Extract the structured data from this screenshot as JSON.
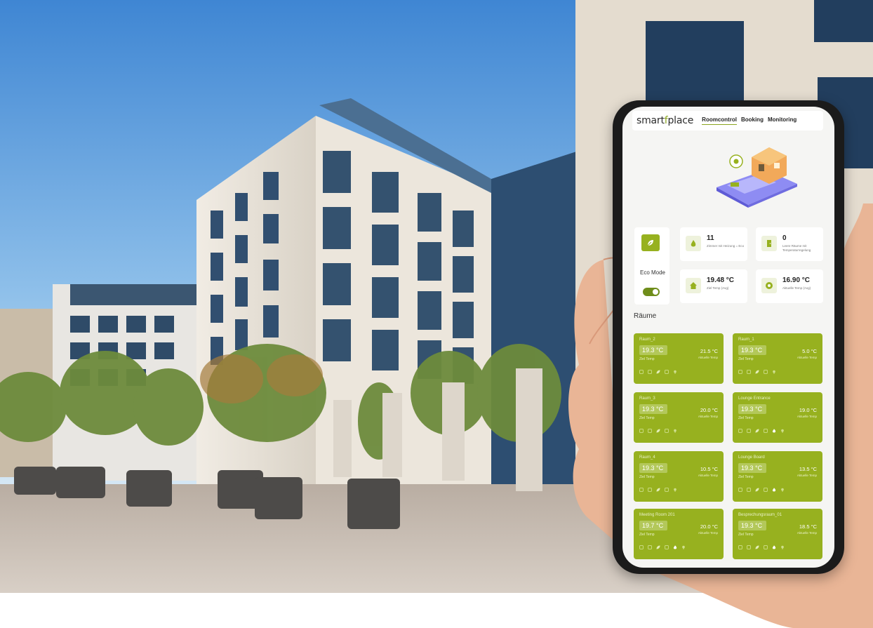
{
  "app": {
    "brand_prefix": "smart",
    "brand_mid": "f",
    "brand_suffix": "place",
    "tabs": [
      {
        "label": "Roomcontrol",
        "active": true
      },
      {
        "label": "Booking",
        "active": false
      },
      {
        "label": "Monitoring",
        "active": false
      }
    ]
  },
  "eco": {
    "label": "Eco Mode",
    "toggle_on": true
  },
  "stats": [
    {
      "value": "11",
      "label": "Zimmer mit Heizung = Eco",
      "icon": "flame-icon"
    },
    {
      "value": "0",
      "label": "Leere Räume mit Temperaturregelung",
      "icon": "door-icon"
    },
    {
      "value": "19.48 °C",
      "label": "Ziel Temp (Avg)",
      "icon": "home-icon"
    },
    {
      "value": "16.90 °C",
      "label": "Aktuelle Temp (Avg)",
      "icon": "thermo-icon"
    }
  ],
  "rooms_title": "Räume",
  "rooms": [
    {
      "name": "Raum_2",
      "target": "19.3 °C",
      "target_label": "Ziel Temp",
      "actual": "21.5 °C",
      "actual_label": "Aktuelle Temp",
      "flame": false
    },
    {
      "name": "Raum_1",
      "target": "19.3 °C",
      "target_label": "Ziel Temp",
      "actual": "5.0 °C",
      "actual_label": "Aktuelle Temp",
      "flame": false
    },
    {
      "name": "Raum_3",
      "target": "19.3 °C",
      "target_label": "Ziel Temp",
      "actual": "20.0 °C",
      "actual_label": "Aktuelle Temp",
      "flame": false
    },
    {
      "name": "Lounge Entrance",
      "target": "19.3 °C",
      "target_label": "Ziel Temp",
      "actual": "19.0 °C",
      "actual_label": "Aktuelle Temp",
      "flame": true
    },
    {
      "name": "Raum_4",
      "target": "19.3 °C",
      "target_label": "Ziel Temp",
      "actual": "10.5 °C",
      "actual_label": "Aktuelle Temp",
      "flame": false
    },
    {
      "name": "Lounge Board",
      "target": "19.3 °C",
      "target_label": "Ziel Temp",
      "actual": "13.5 °C",
      "actual_label": "Aktuelle Temp",
      "flame": true
    },
    {
      "name": "Meeting Room 201",
      "target": "19.7 °C",
      "target_label": "Ziel Temp",
      "actual": "20.0 °C",
      "actual_label": "Aktuelle Temp",
      "flame": true
    },
    {
      "name": "Besprechungsraum_01",
      "target": "19.3 °C",
      "target_label": "Ziel Temp",
      "actual": "18.5 °C",
      "actual_label": "Aktuelle Temp",
      "flame": true
    }
  ],
  "colors": {
    "accent": "#97b11f",
    "accent_dark": "#6f8d1b",
    "sky_top": "#4f8fd6",
    "sky_bottom": "#cfe3f3",
    "facade": "#e7e2d9",
    "pavement": "#c9bfb4"
  }
}
